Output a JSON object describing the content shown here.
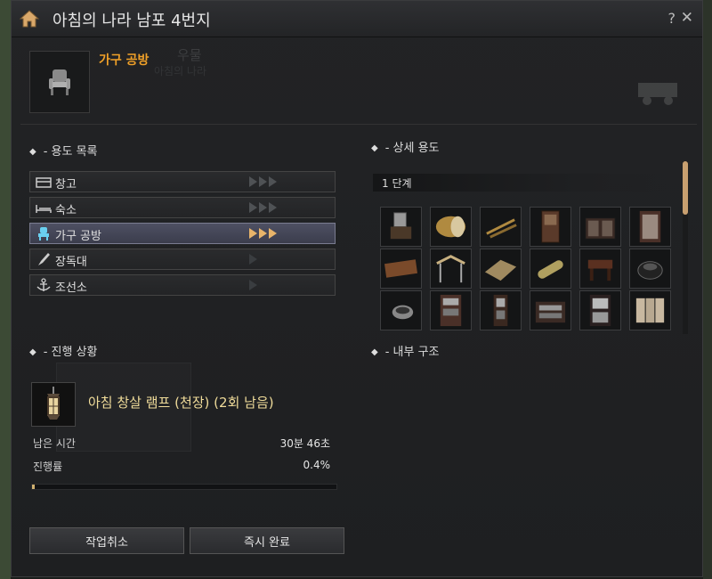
{
  "window": {
    "title": "아침의 나라 남포 4번지",
    "help": "?",
    "close": "✕"
  },
  "workshop": {
    "name": "가구 공방",
    "ghost_title": "아침의 나라",
    "ghost_sub": "우물"
  },
  "sections": {
    "usage_list": "- 용도 목록",
    "detail_usage": "- 상세 용도",
    "progress": "- 진행 상황",
    "interior": "- 내부 구조"
  },
  "usage_items": [
    {
      "label": "창고",
      "icon": "chest-icon",
      "level": 0,
      "max": 3,
      "active": false
    },
    {
      "label": "숙소",
      "icon": "bed-icon",
      "level": 0,
      "max": 3,
      "active": false
    },
    {
      "label": "가구 공방",
      "icon": "chair-icon",
      "level": 3,
      "max": 3,
      "active": true
    },
    {
      "label": "장독대",
      "icon": "brush-icon",
      "level": 0,
      "max": 1,
      "active": false
    },
    {
      "label": "조선소",
      "icon": "anchor-icon",
      "level": 0,
      "max": 1,
      "active": false
    }
  ],
  "stage": {
    "label": "1 단계"
  },
  "furniture_icons": [
    "vanity-mirror-icon",
    "drum-icon",
    "wooden-sticks-icon",
    "tall-cabinet-icon",
    "low-cabinet-icon",
    "screen-cabinet-icon",
    "wooden-plank-icon",
    "tent-frame-icon",
    "straw-mat-icon",
    "rolled-mat-icon",
    "wooden-table-icon",
    "iron-pot-icon",
    "stone-bowl-icon",
    "display-shelf-icon",
    "narrow-shelf-icon",
    "inlaid-chest-icon",
    "mother-of-pearl-cabinet-icon",
    "folding-screen-icon"
  ],
  "progress": {
    "item": "아침 창살 램프 (천장) (2회 남음)",
    "item_icon": "lamp-icon",
    "remaining_label": "남은 시간",
    "remaining_value": "30분 46초",
    "rate_label": "진행률",
    "rate_value": "0.4%",
    "rate_fraction": 0.004
  },
  "buttons": {
    "cancel": "작업취소",
    "complete": "즉시 완료"
  },
  "colors": {
    "accent": "#f0a028",
    "progress_text": "#f0dc9a",
    "arrow_lit": "#e8b46a",
    "active_row": "#4e5063"
  }
}
